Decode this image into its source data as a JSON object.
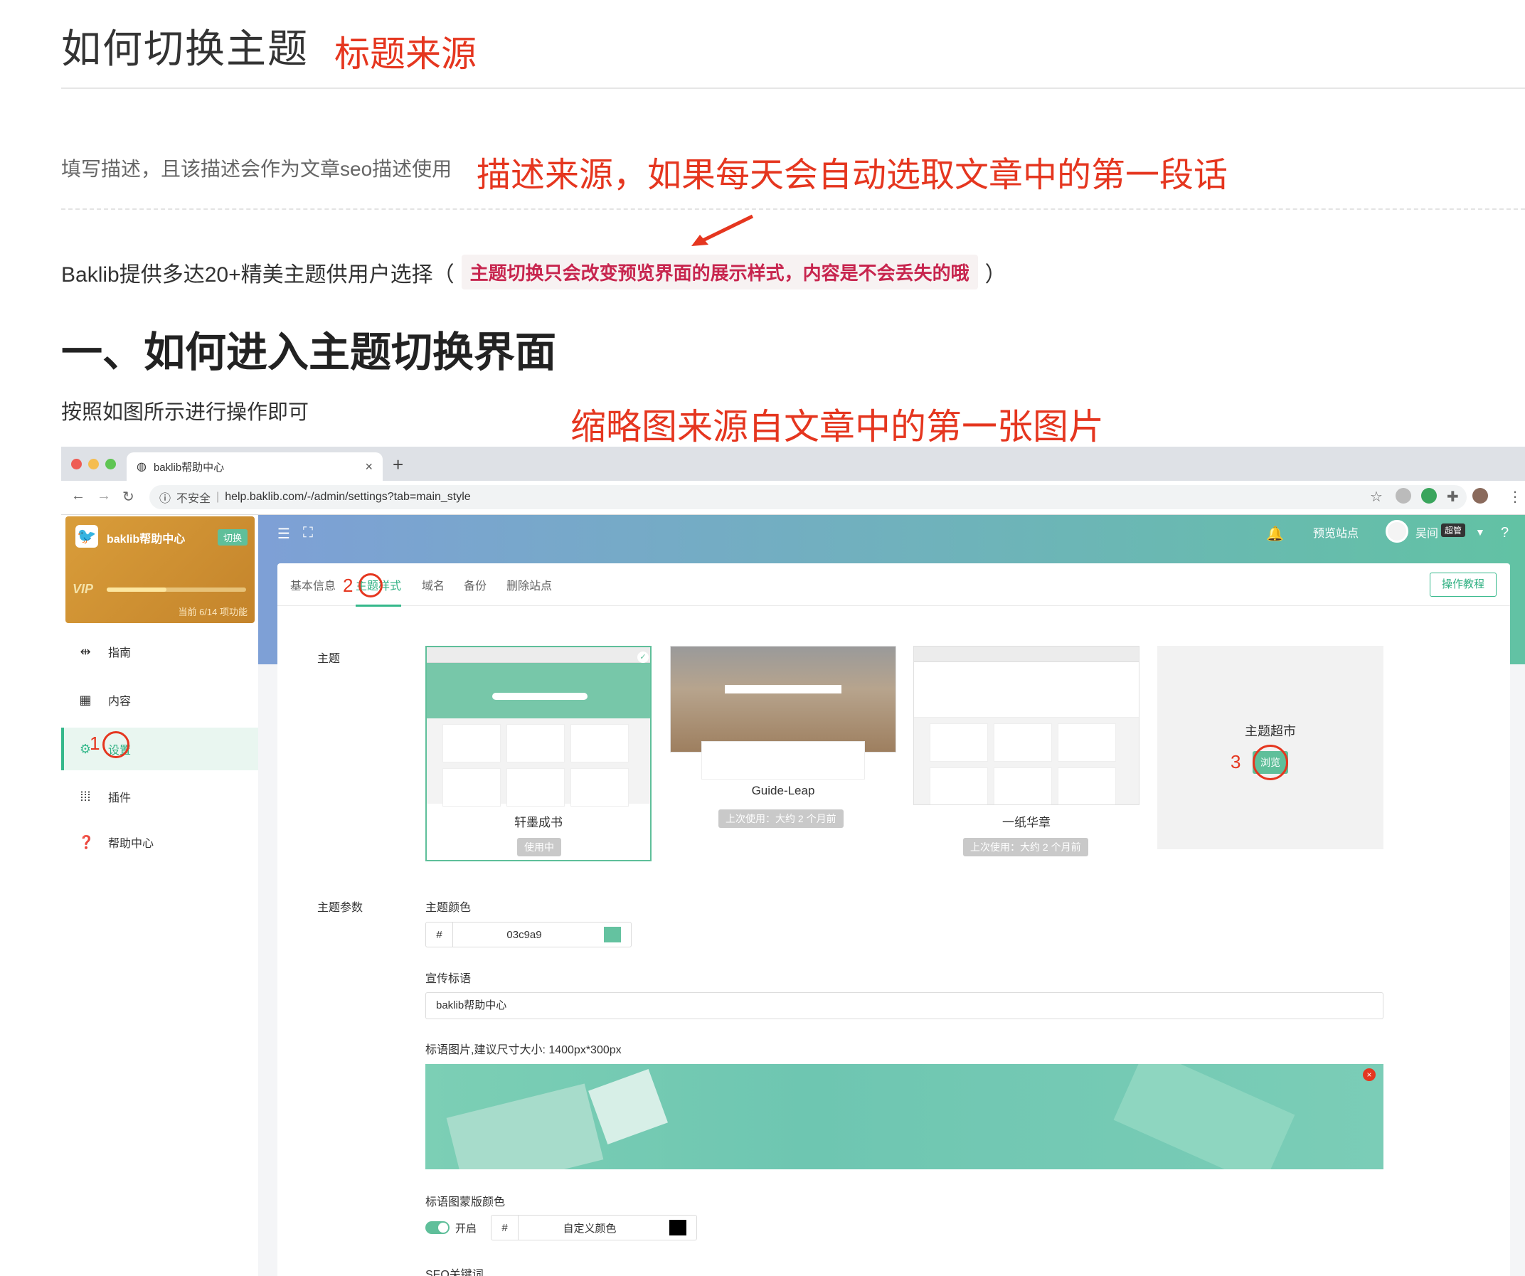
{
  "article": {
    "title": "如何切换主题",
    "annotation_title": "标题来源",
    "description": "填写描述，且该描述会作为文章seo描述使用",
    "annotation_description": "描述来源，如果每天会自动选取文章中的第一段话",
    "intro_prefix": "Baklib提供多达20+精美主题供用户选择（",
    "intro_code": "主题切换只会改变预览界面的展示样式，内容是不会丢失的哦",
    "intro_suffix": "）",
    "heading": "一、如何进入主题切换界面",
    "follow_text": "按照如图所示进行操作即可",
    "annotation_thumbnail": "缩略图来源自文章中的第一张图片"
  },
  "browser": {
    "tab_title": "baklib帮助中心",
    "tab_close": "×",
    "new_tab": "+",
    "insecure_label": "不安全",
    "url": "help.baklib.com/-/admin/settings?tab=main_style"
  },
  "sidebar": {
    "site_name": "baklib帮助中心",
    "switch_label": "切换",
    "vip_label": "VIP",
    "vip_progress": 0.43,
    "vip_count": "当前 6/14 项功能",
    "items": [
      {
        "label": "指南",
        "icon": "signpost-icon"
      },
      {
        "label": "内容",
        "icon": "grid-icon"
      },
      {
        "label": "设置",
        "icon": "gear-icon"
      },
      {
        "label": "插件",
        "icon": "apps-icon"
      },
      {
        "label": "帮助中心",
        "icon": "help-icon"
      }
    ]
  },
  "topbar": {
    "preview_site": "预览站点",
    "user_name": "吴间",
    "role": "超管"
  },
  "settings_tabs": [
    "基本信息",
    "主题样式",
    "域名",
    "备份",
    "删除站点"
  ],
  "guide_button": "操作教程",
  "theme_section": {
    "label": "主题",
    "themes": [
      {
        "name": "轩墨成书",
        "status": "使用中"
      },
      {
        "name": "Guide-Leap",
        "status": "上次使用：大约 2 个月前"
      },
      {
        "name": "一纸华章",
        "status": "上次使用：大约 2 个月前"
      }
    ],
    "market_title": "主题超市",
    "market_button": "浏览"
  },
  "steps": [
    "1",
    "2",
    "3"
  ],
  "params": {
    "label": "主题参数",
    "color_label": "主题颜色",
    "hash": "#",
    "color_value": "03c9a9",
    "color_hex": "#64c2a0",
    "slogan_label": "宣传标语",
    "slogan_value": "baklib帮助中心",
    "hero_label": "标语图片,建议尺寸大小: 1400px*300px",
    "overlay_label": "标语图蒙版颜色",
    "toggle_label": "开启",
    "overlay_value": "自定义颜色",
    "overlay_hex": "#000000",
    "seo_label": "SEO关键词"
  },
  "colors": {
    "annotation": "#e5361f",
    "accent": "#35b88b"
  }
}
